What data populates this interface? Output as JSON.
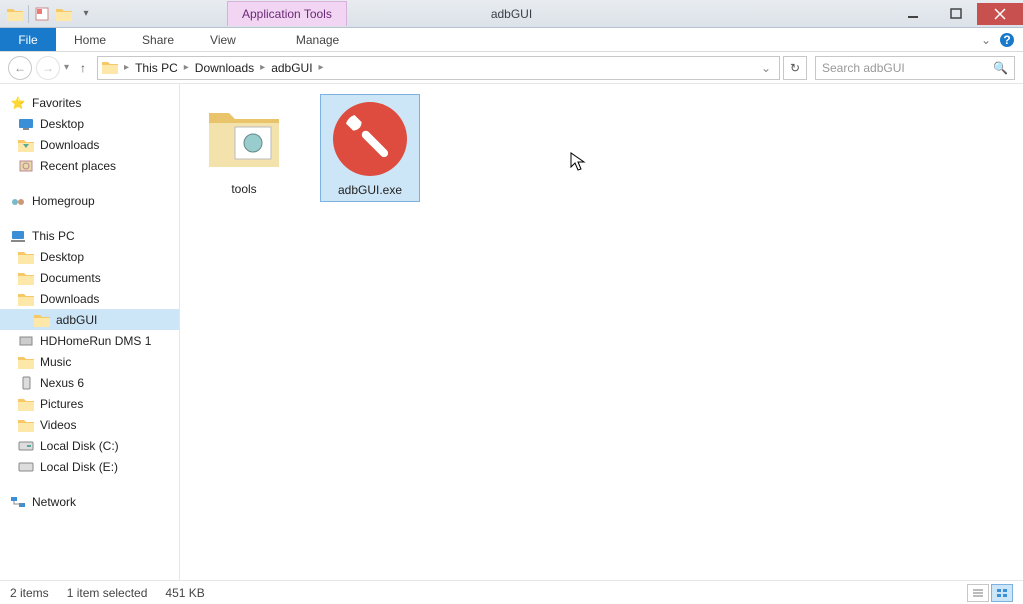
{
  "title": "adbGUI",
  "ribbon_context": "Application Tools",
  "ribbon": {
    "file": "File",
    "home": "Home",
    "share": "Share",
    "view": "View",
    "manage": "Manage"
  },
  "breadcrumb": [
    "This PC",
    "Downloads",
    "adbGUI"
  ],
  "search": {
    "placeholder": "Search adbGUI"
  },
  "tree": {
    "favorites": {
      "label": "Favorites",
      "items": [
        "Desktop",
        "Downloads",
        "Recent places"
      ]
    },
    "homegroup": "Homegroup",
    "thispc": {
      "label": "This PC",
      "items": [
        "Desktop",
        "Documents",
        "Downloads",
        "adbGUI",
        "HDHomeRun DMS 1",
        "Music",
        "Nexus 6",
        "Pictures",
        "Videos",
        "Local Disk (C:)",
        "Local Disk (E:)"
      ]
    },
    "network": "Network"
  },
  "files": {
    "tools": "tools",
    "exe": "adbGUI.exe"
  },
  "status": {
    "count": "2 items",
    "selected": "1 item selected",
    "size": "451 KB"
  }
}
